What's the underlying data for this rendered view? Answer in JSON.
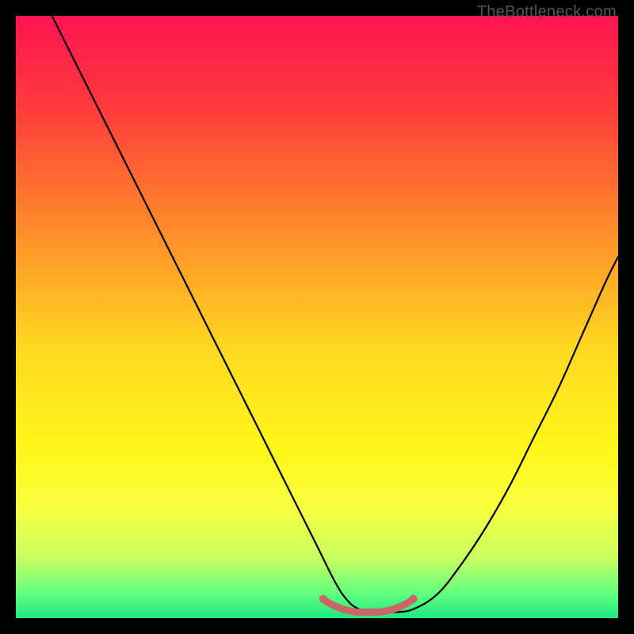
{
  "watermark": "TheBottleneck.com",
  "chart_data": {
    "type": "line",
    "title": "",
    "xlabel": "",
    "ylabel": "",
    "xlim": [
      0,
      100
    ],
    "ylim": [
      0,
      100
    ],
    "background_gradient": {
      "stops": [
        {
          "pos": 0.0,
          "color": "#ff1450"
        },
        {
          "pos": 0.15,
          "color": "#ff3a3d"
        },
        {
          "pos": 0.35,
          "color": "#ff8a2a"
        },
        {
          "pos": 0.55,
          "color": "#ffd820"
        },
        {
          "pos": 0.72,
          "color": "#fff71a"
        },
        {
          "pos": 0.82,
          "color": "#f7ff40"
        },
        {
          "pos": 0.9,
          "color": "#c8ff60"
        },
        {
          "pos": 0.96,
          "color": "#60ff80"
        },
        {
          "pos": 1.0,
          "color": "#20e880"
        }
      ]
    },
    "series": [
      {
        "name": "bottleneck-curve",
        "color": "#000000",
        "width": 2.2,
        "x": [
          6,
          10,
          14,
          18,
          22,
          26,
          30,
          34,
          38,
          42,
          46,
          50,
          53,
          55,
          57,
          60,
          63,
          66,
          70,
          74,
          78,
          82,
          86,
          90,
          94,
          98,
          100
        ],
        "y": [
          100,
          92,
          84,
          76,
          68,
          60,
          52,
          44,
          36,
          28,
          20,
          12,
          6,
          3,
          1.5,
          1,
          1,
          1.5,
          4,
          9,
          15,
          22,
          30,
          38,
          47,
          56,
          60
        ]
      },
      {
        "name": "optimal-range-marker",
        "color": "#cc6666",
        "width": 9,
        "x": [
          51,
          52,
          53,
          54,
          55,
          56,
          57,
          58,
          59,
          60,
          61,
          62,
          63,
          64,
          65,
          66
        ],
        "y": [
          3.2,
          2.5,
          2.0,
          1.6,
          1.3,
          1.1,
          1.0,
          1.0,
          1.0,
          1.0,
          1.1,
          1.3,
          1.6,
          2.0,
          2.5,
          3.2
        ]
      }
    ]
  }
}
